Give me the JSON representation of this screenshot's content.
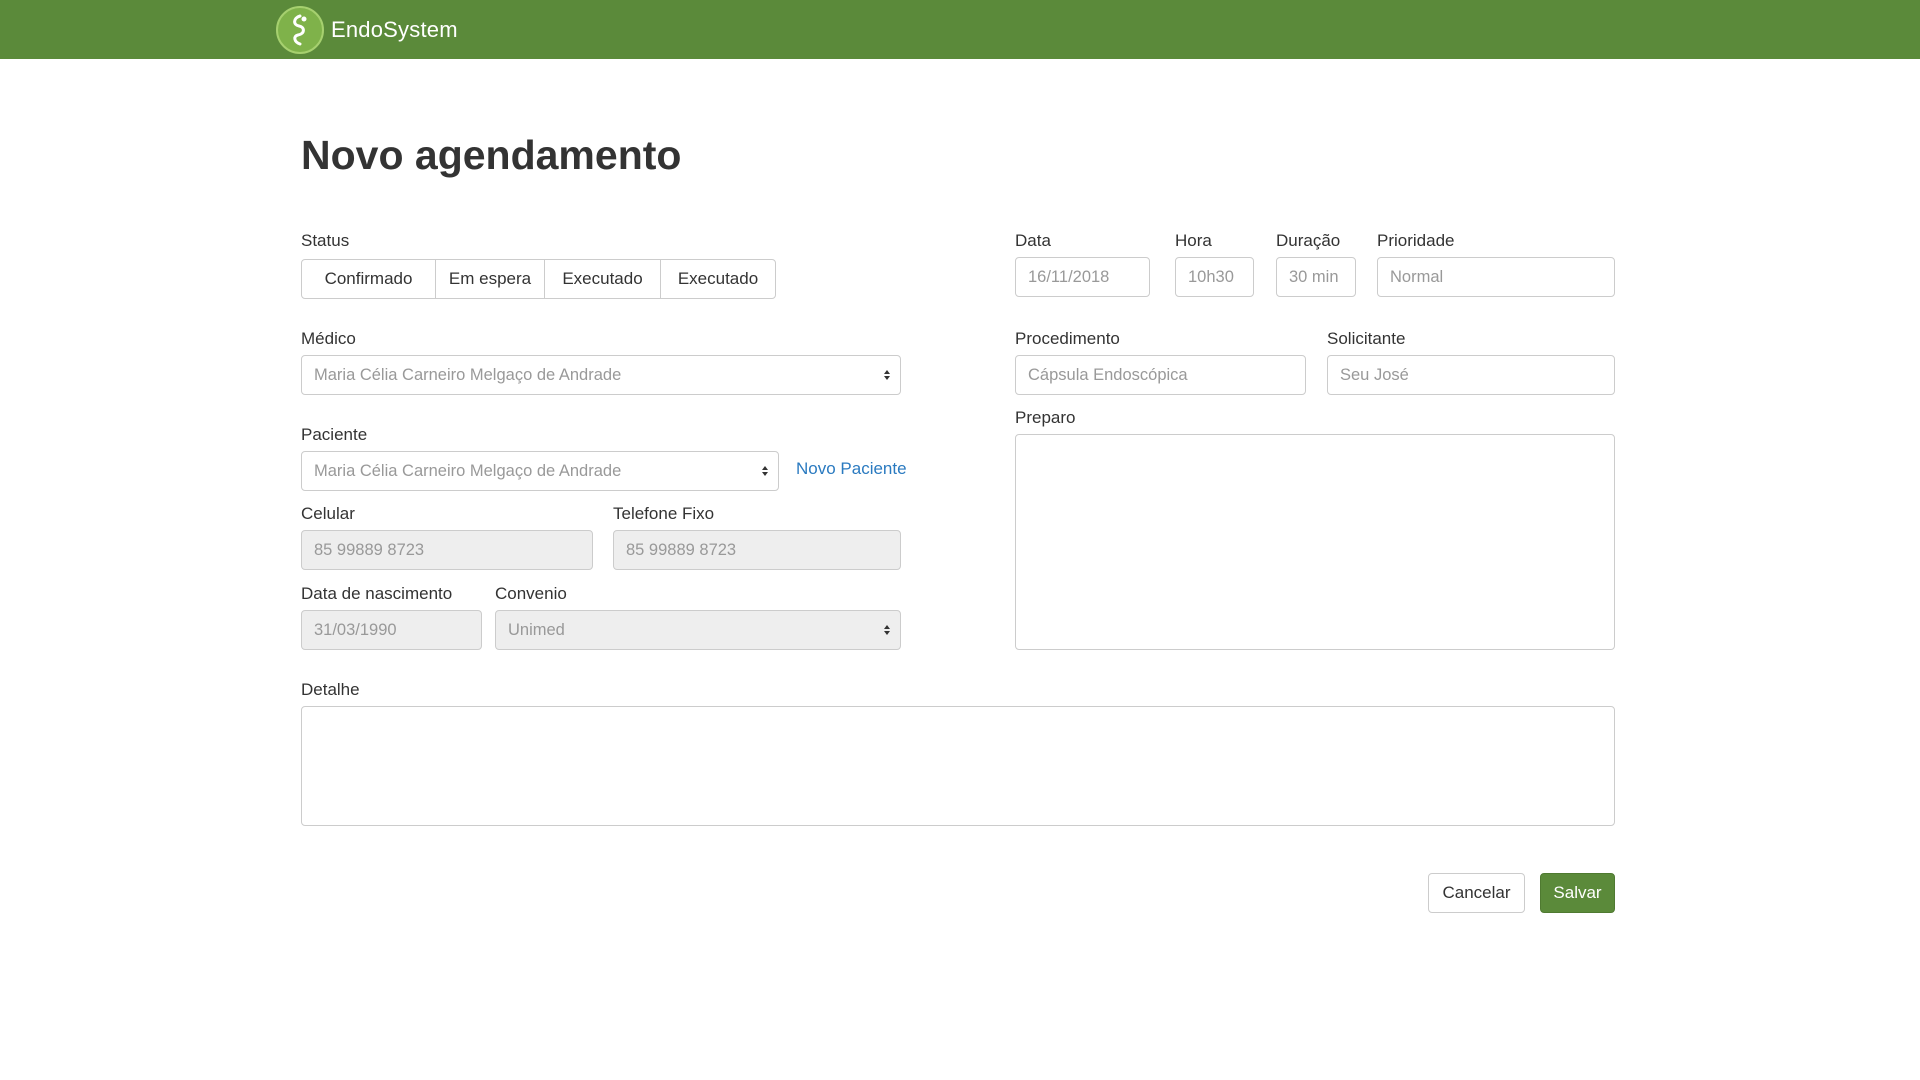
{
  "app": {
    "brand": "EndoSystem"
  },
  "page": {
    "title": "Novo agendamento"
  },
  "form": {
    "status": {
      "label": "Status",
      "options": [
        "Confirmado",
        "Em espera",
        "Executado",
        "Executado"
      ]
    },
    "medico": {
      "label": "Médico",
      "value": "Maria Célia Carneiro Melgaço de Andrade"
    },
    "paciente": {
      "label": "Paciente",
      "value": "Maria Célia Carneiro Melgaço de Andrade",
      "new_link": "Novo Paciente"
    },
    "celular": {
      "label": "Celular",
      "value": "85 99889 8723"
    },
    "telefone_fixo": {
      "label": "Telefone Fixo",
      "value": "85 99889 8723"
    },
    "data_nascimento": {
      "label": "Data de nascimento",
      "value": "31/03/1990"
    },
    "convenio": {
      "label": "Convenio",
      "value": "Unimed"
    },
    "data": {
      "label": "Data",
      "value": "16/11/2018"
    },
    "hora": {
      "label": "Hora",
      "value": "10h30"
    },
    "duracao": {
      "label": "Duração",
      "value": "30 min"
    },
    "prioridade": {
      "label": "Prioridade",
      "value": "Normal"
    },
    "procedimento": {
      "label": "Procedimento",
      "value": "Cápsula Endoscópica"
    },
    "solicitante": {
      "label": "Solicitante",
      "value": "Seu José"
    },
    "preparo": {
      "label": "Preparo",
      "value": ""
    },
    "detalhe": {
      "label": "Detalhe",
      "value": ""
    }
  },
  "actions": {
    "cancel_label": "Cancelar",
    "save_label": "Salvar"
  },
  "colors": {
    "navbar": "#5b8a3a",
    "primary_button": "#5b8a3a",
    "link": "#2a7ac0"
  },
  "icons": {
    "logo": "endosystem-logo-icon",
    "select": "select-arrows-icon"
  }
}
